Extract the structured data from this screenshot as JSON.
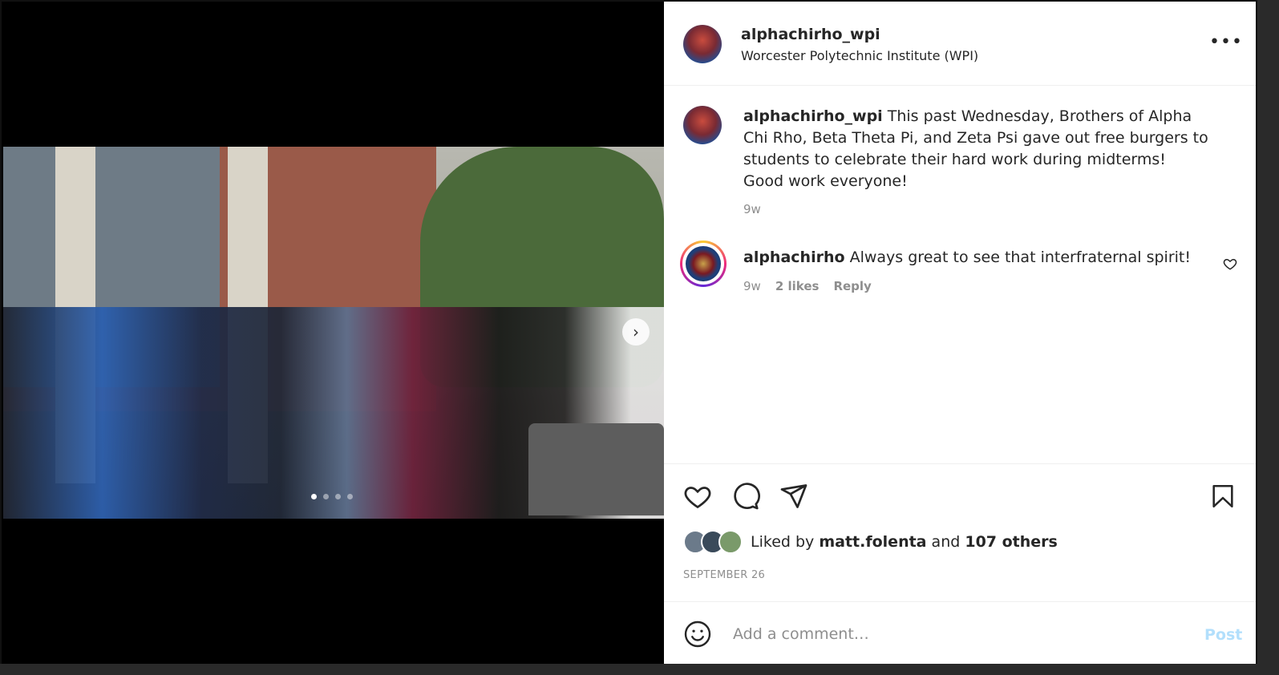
{
  "post": {
    "username": "alphachirho_wpi",
    "location": "Worcester Polytechnic Institute (WPI)",
    "caption": "This past Wednesday, Brothers of Alpha Chi Rho, Beta Theta Pi, and Zeta Psi gave out free burgers to students to celebrate their hard work during midterms! Good work everyone!",
    "caption_age": "9w",
    "carousel": {
      "total_images": 4,
      "current_index": 1
    }
  },
  "comments": [
    {
      "username": "alphachirho",
      "text": "Always great to see that interfraternal spirit!",
      "age": "9w",
      "likes_label": "2 likes",
      "reply_label": "Reply"
    }
  ],
  "likes": {
    "prefix": "Liked by",
    "first_user": "matt.folenta",
    "joiner": "and",
    "others": "107 others"
  },
  "date": "SEPTEMBER 26",
  "add_comment": {
    "placeholder": "Add a comment…",
    "post_label": "Post"
  },
  "icons": [
    "more-icon",
    "heart-icon",
    "comment-icon",
    "share-icon",
    "bookmark-icon",
    "emoji-icon",
    "chevron-right-icon"
  ],
  "colors": {
    "link_disabled": "#b2dffc",
    "meta": "#8e8e8e"
  }
}
